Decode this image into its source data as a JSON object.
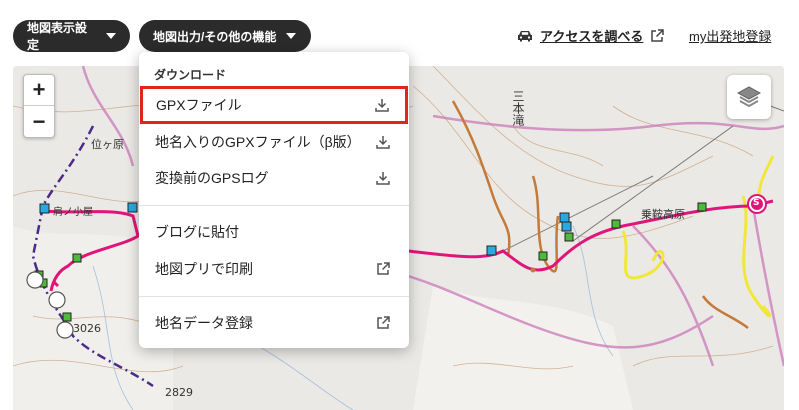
{
  "toolbar": {
    "map_settings_label": "地図表示設定",
    "output_menu_label": "地図出力/その他の機能",
    "access_label": "アクセスを調べる",
    "my_start_label": "my出発地登録"
  },
  "map": {
    "zoom_in": "+",
    "zoom_out": "−",
    "labels": {
      "falls": "三本滝",
      "mountain_left": "位ヶ原",
      "plateau": "乗鞍高原",
      "peak_left": "肩ノ小屋",
      "elev_3026": "3026",
      "elev_2829": "2829",
      "start_mark": "S"
    }
  },
  "dropdown": {
    "header": "ダウンロード",
    "items": [
      {
        "label": "GPXファイル",
        "icon": "download-icon",
        "highlighted": true
      },
      {
        "label": "地名入りのGPXファイル（β版）",
        "icon": "download-icon"
      },
      {
        "label": "変換前のGPSログ",
        "icon": "download-icon"
      },
      {
        "label": "ブログに貼付",
        "icon": ""
      },
      {
        "label": "地図プリで印刷",
        "icon": "external-link-icon"
      },
      {
        "label": "地名データ登録",
        "icon": "external-link-icon"
      }
    ]
  },
  "colors": {
    "highlight_border": "#e0261b",
    "route": "#e0157a",
    "toolbar_pill": "#2b2b2b"
  }
}
